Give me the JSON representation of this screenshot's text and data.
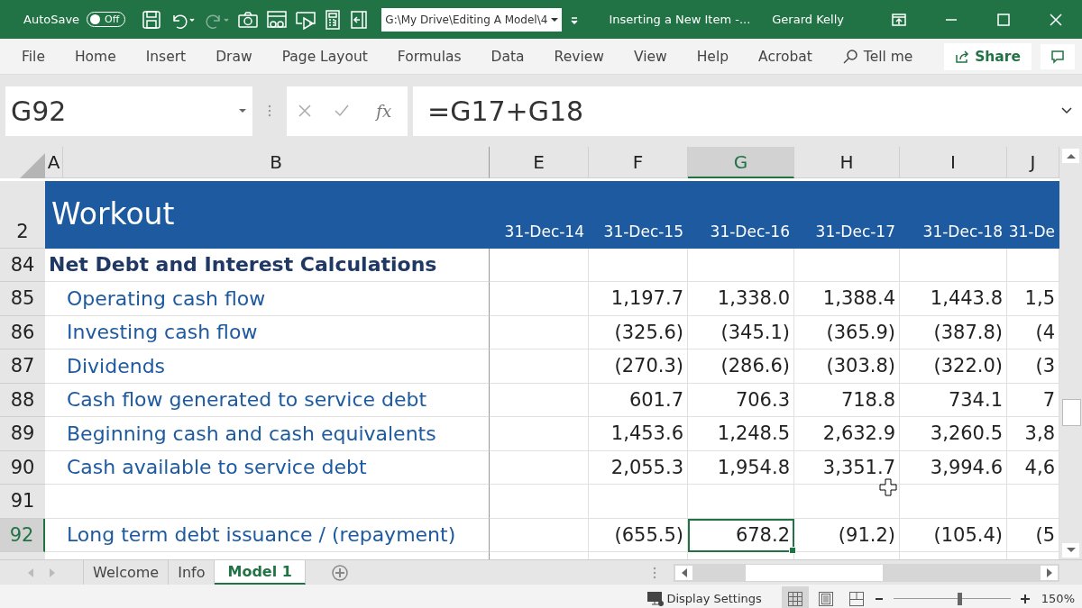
{
  "title_bar": {
    "autosave_label": "AutoSave",
    "autosave_toggle": {
      "label": "Off",
      "on": false
    },
    "path": "G:\\My Drive\\Editing A Model\\4",
    "document_title": "Inserting a New Item -...",
    "user": "Gerard Kelly"
  },
  "ribbon_tabs": [
    {
      "label": "File"
    },
    {
      "label": "Home"
    },
    {
      "label": "Insert"
    },
    {
      "label": "Draw"
    },
    {
      "label": "Page Layout"
    },
    {
      "label": "Formulas"
    },
    {
      "label": "Data"
    },
    {
      "label": "Review"
    },
    {
      "label": "View"
    },
    {
      "label": "Help"
    },
    {
      "label": "Acrobat"
    }
  ],
  "tell_me": "Tell me",
  "share": "Share",
  "formula_bar": {
    "name_box": "G92",
    "fx": "fx",
    "formula": "=G17+G18"
  },
  "columns": [
    {
      "label": "A",
      "selected": false
    },
    {
      "label": "B",
      "selected": false
    },
    {
      "label": "E",
      "selected": false
    },
    {
      "label": "F",
      "selected": false
    },
    {
      "label": "G",
      "selected": true
    },
    {
      "label": "H",
      "selected": false
    },
    {
      "label": "I",
      "selected": false
    },
    {
      "label": "J",
      "selected": false
    }
  ],
  "rows": [
    {
      "number": "2",
      "selected": false,
      "kind": "title",
      "label": "Workout",
      "cells": [
        "31-Dec-14",
        "31-Dec-15",
        "31-Dec-16",
        "31-Dec-17",
        "31-Dec-18",
        "31-De"
      ]
    },
    {
      "number": "84",
      "selected": false,
      "kind": "section",
      "label": "Net Debt and Interest Calculations",
      "cells": [
        "",
        "",
        "",
        "",
        "",
        ""
      ]
    },
    {
      "number": "85",
      "selected": false,
      "kind": "item",
      "label": "Operating cash flow",
      "cells": [
        "",
        "1,197.7",
        "1,338.0",
        "1,388.4",
        "1,443.8",
        "1,5"
      ]
    },
    {
      "number": "86",
      "selected": false,
      "kind": "item",
      "label": "Investing cash flow",
      "cells": [
        "",
        "(325.6)",
        "(345.1)",
        "(365.9)",
        "(387.8)",
        "(4"
      ]
    },
    {
      "number": "87",
      "selected": false,
      "kind": "item",
      "label": "Dividends",
      "cells": [
        "",
        "(270.3)",
        "(286.6)",
        "(303.8)",
        "(322.0)",
        "(3"
      ]
    },
    {
      "number": "88",
      "selected": false,
      "kind": "item",
      "label": "Cash flow generated to service debt",
      "cells": [
        "",
        "601.7",
        "706.3",
        "718.8",
        "734.1",
        "7"
      ]
    },
    {
      "number": "89",
      "selected": false,
      "kind": "item",
      "label": "Beginning cash and cash equivalents",
      "cells": [
        "",
        "1,453.6",
        "1,248.5",
        "2,632.9",
        "3,260.5",
        "3,8"
      ]
    },
    {
      "number": "90",
      "selected": false,
      "kind": "item",
      "label": "Cash available to service debt",
      "cells": [
        "",
        "2,055.3",
        "1,954.8",
        "3,351.7",
        "3,994.6",
        "4,6"
      ]
    },
    {
      "number": "91",
      "selected": false,
      "kind": "blank",
      "label": "",
      "cells": [
        "",
        "",
        "",
        "",
        "",
        ""
      ]
    },
    {
      "number": "92",
      "selected": true,
      "kind": "item",
      "label": "Long term debt issuance / (repayment)",
      "cells": [
        "",
        "(655.5)",
        "678.2",
        "(91.2)",
        "(105.4)",
        "(5"
      ]
    }
  ],
  "sheet_tabs": [
    {
      "label": "Welcome",
      "selected": false
    },
    {
      "label": "Info",
      "selected": false
    },
    {
      "label": "Model 1",
      "selected": true
    }
  ],
  "status_bar": {
    "display_settings": "Display Settings",
    "view_buttons": [
      {
        "kind": "normal",
        "selected": true
      },
      {
        "kind": "page_layout",
        "selected": false
      },
      {
        "kind": "page_break",
        "selected": false
      }
    ],
    "zoom": {
      "level": 0.56,
      "reading": "150%"
    }
  }
}
